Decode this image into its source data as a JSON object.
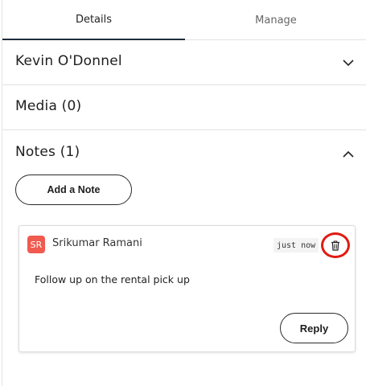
{
  "tabs": [
    {
      "label": "Details"
    },
    {
      "label": "Manage"
    }
  ],
  "sections": {
    "contact": {
      "title": "Kevin O'Donnel",
      "icon": "chevron-down-icon"
    },
    "media": {
      "title": "Media (0)"
    },
    "notes": {
      "title": "Notes (1)",
      "icon": "chevron-up-icon"
    }
  },
  "notes_panel": {
    "add_button_label": "Add a Note",
    "items": [
      {
        "avatar_initials": "SR",
        "avatar_color": "#f05a4f",
        "author": "Srikumar Ramani",
        "timestamp": "just now",
        "delete_icon": "trash-icon",
        "body": "Follow up on the rental pick up",
        "reply_label": "Reply"
      }
    ]
  },
  "colors": {
    "accent": "#1f2d3d",
    "highlight": "#e01b10"
  }
}
